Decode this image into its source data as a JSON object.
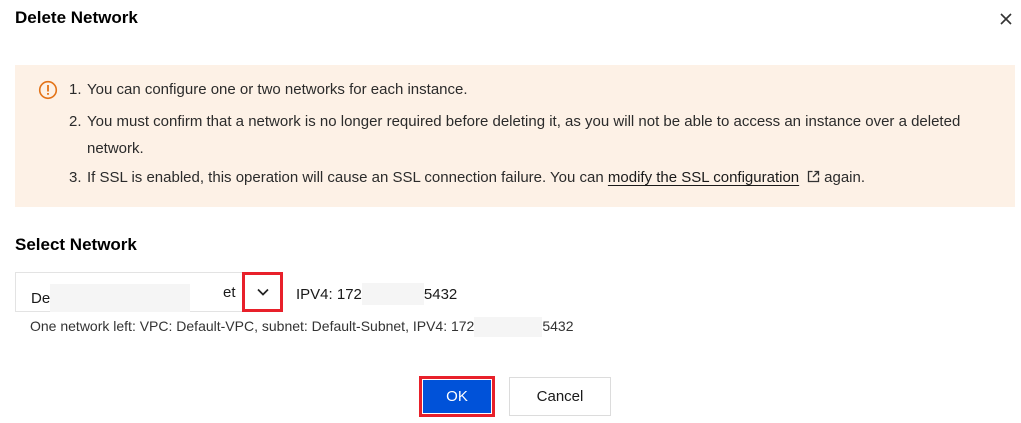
{
  "dialog": {
    "title": "Delete Network",
    "close_icon": "close-icon"
  },
  "alert": {
    "icon": "warning-circle-icon",
    "items": [
      {
        "num": "1.",
        "text": "You can configure one or two networks for each instance."
      },
      {
        "num": "2.",
        "text": "You must confirm that a network is no longer required before deleting it, as you will not be able to access an instance over a deleted network."
      },
      {
        "num": "3.",
        "text_before": "If SSL is enabled, this operation will cause an SSL connection failure. You can ",
        "link": "modify the SSL configuration",
        "link_icon": "external-link-icon",
        "text_after": "again."
      }
    ],
    "colors": {
      "background": "#fdf1e6",
      "icon": "#e37318"
    }
  },
  "network": {
    "section_title": "Select Network",
    "select_value_start": "De",
    "select_value_end": "et",
    "chevron_icon": "chevron-down-icon",
    "ipv4_prefix": "IPV4: 172",
    "ipv4_suffix": "5432",
    "note_prefix": "One network left: VPC: Default-VPC, subnet: Default-Subnet, IPV4: 172",
    "note_suffix": "5432"
  },
  "footer": {
    "ok_label": "OK",
    "cancel_label": "Cancel",
    "colors": {
      "primary": "#0052d9",
      "highlight": "#e8202a"
    }
  }
}
